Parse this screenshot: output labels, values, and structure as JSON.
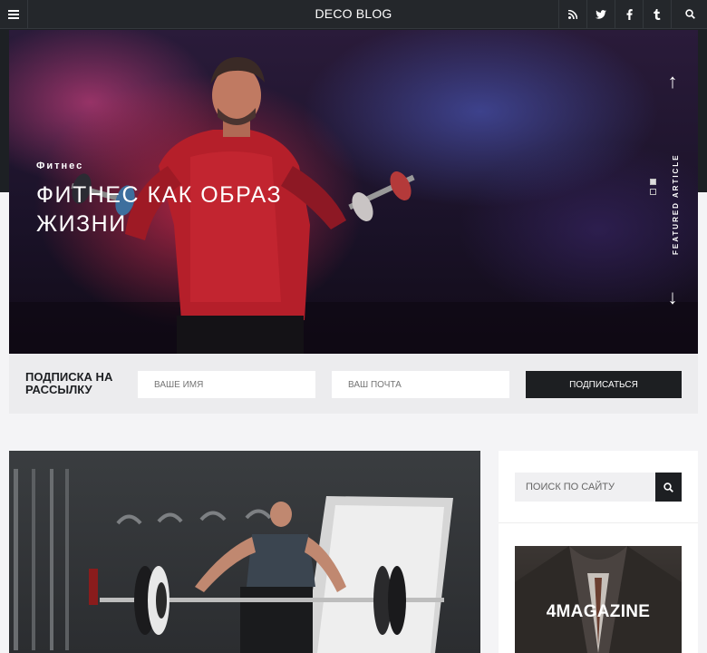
{
  "header": {
    "menu_icon": "hamburger-icon",
    "brand": "DECO BLOG",
    "icons": [
      "rss-icon",
      "twitter-icon",
      "facebook-icon",
      "tumblr-icon",
      "search-icon"
    ]
  },
  "hero": {
    "category": "Фитнес",
    "title": "ФИТНЕС КАК ОБРАЗ ЖИЗНИ",
    "featured_label": "FEATURED ARTICLE",
    "arrow_up": "↑",
    "arrow_down": "↓"
  },
  "newsletter": {
    "title": "ПОДПИСКА НА РАССЫЛКУ",
    "name_placeholder": "ВАШЕ ИМЯ",
    "email_placeholder": "ВАШ ПОЧТА",
    "submit_label": "ПОДПИСАТЬСЯ"
  },
  "sidebar": {
    "search_placeholder": "ПОИСК ПО САЙТУ",
    "banner_title": "4MAGAZINE"
  },
  "colors": {
    "dark": "#1d1f22",
    "topbar": "#24272b",
    "hero_red": "#c8283c",
    "hero_blue": "#4650aa"
  }
}
